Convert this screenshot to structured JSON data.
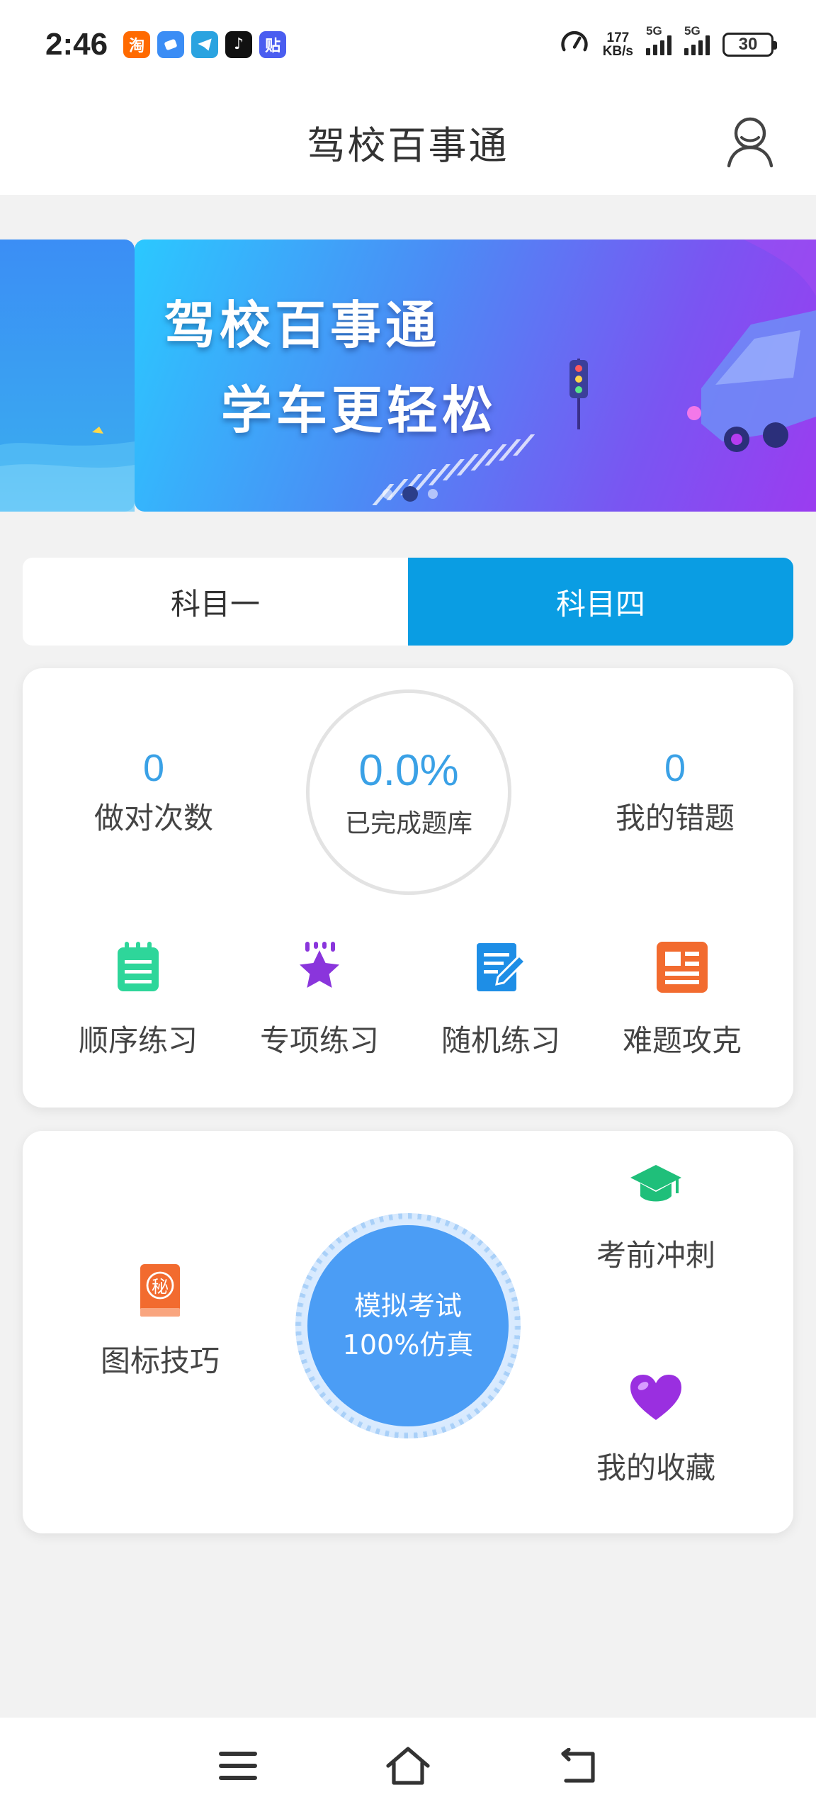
{
  "status_bar": {
    "time": "2:46",
    "apps": [
      {
        "name": "taobao-icon",
        "glyph": "淘",
        "color": "#ff6a00"
      },
      {
        "name": "browser-icon",
        "glyph": "",
        "color": "#3b8df5"
      },
      {
        "name": "telegram-icon",
        "glyph": "",
        "color": "#2aa3e0"
      },
      {
        "name": "tiktok-icon",
        "glyph": "♪",
        "color": "#111111"
      },
      {
        "name": "tieba-icon",
        "glyph": "贴",
        "color": "#4a5df0"
      }
    ],
    "network_speed_value": "177",
    "network_speed_unit": "KB/s",
    "signal1_label": "5G",
    "signal2_label": "5G",
    "battery": "30"
  },
  "header": {
    "title": "驾校百事通"
  },
  "banner": {
    "line1": "驾校百事通",
    "line2": "学车更轻松",
    "dots": 3,
    "active_dot": 1
  },
  "tabs": [
    {
      "label": "科目一",
      "active": false
    },
    {
      "label": "科目四",
      "active": true
    }
  ],
  "stats": {
    "correct_count": "0",
    "correct_label": "做对次数",
    "progress_value": "0.0%",
    "progress_label": "已完成题库",
    "mistakes_count": "0",
    "mistakes_label": "我的错题"
  },
  "practice": [
    {
      "label": "顺序练习",
      "icon": "notepad-icon",
      "color": "#2ed69a"
    },
    {
      "label": "专项练习",
      "icon": "star-icon",
      "color": "#8a35dc"
    },
    {
      "label": "随机练习",
      "icon": "edit-doc-icon",
      "color": "#1e8ee6"
    },
    {
      "label": "难题攻克",
      "icon": "news-icon",
      "color": "#f26b2f"
    }
  ],
  "exam": {
    "tips_label": "图标技巧",
    "tips_icon_glyph": "秘",
    "mock_line1": "模拟考试",
    "mock_line2": "100%仿真",
    "sprint_label": "考前冲刺",
    "favorites_label": "我的收藏"
  },
  "colors": {
    "accent": "#0a9de3",
    "stat_value": "#3aa1e6",
    "mock_button": "#4b9df5"
  }
}
